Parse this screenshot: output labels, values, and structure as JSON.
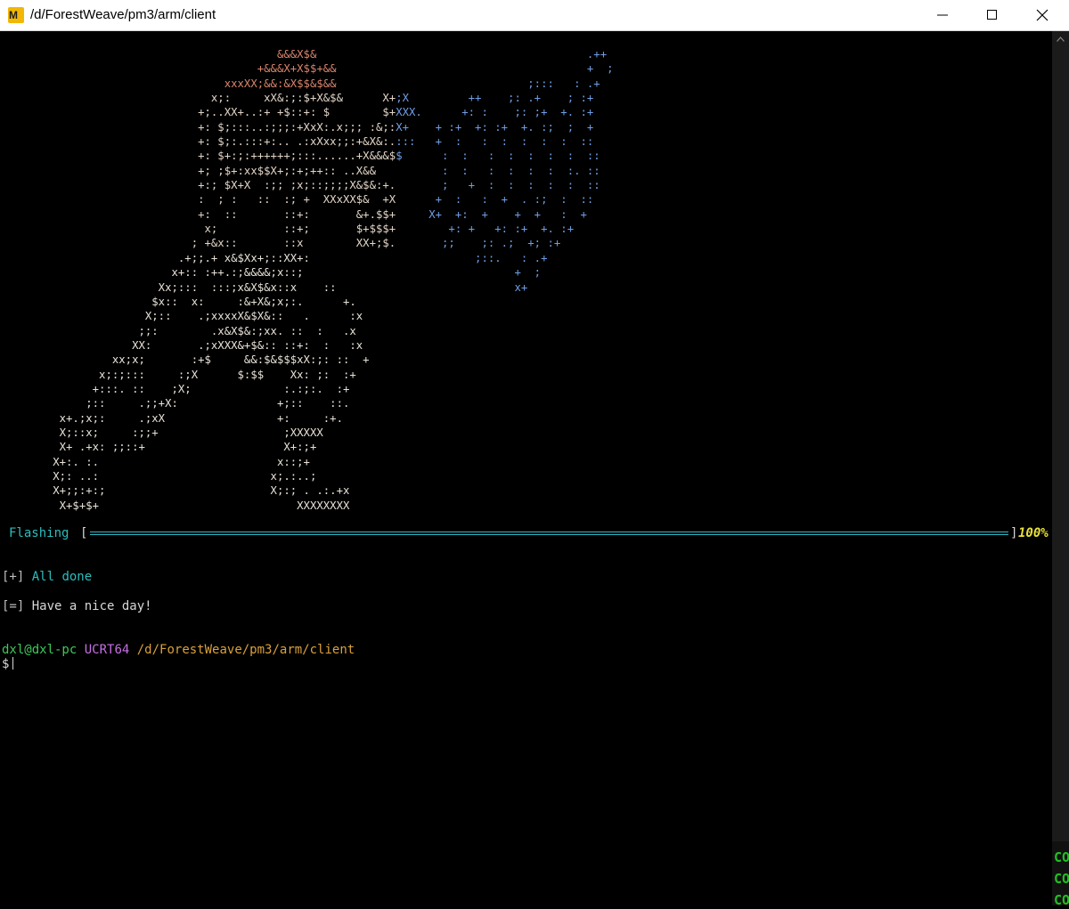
{
  "window": {
    "app_icon": "mintty-icon",
    "app_icon_text": "M",
    "title": "/d/ForestWeave/pm3/arm/client",
    "controls": [
      "minimize-icon",
      "maximize-icon",
      "close-icon"
    ]
  },
  "terminal": {
    "ascii_art_lines": [
      "                                          &&&X$&                                         .++",
      "                                       +&&&X+X$$+&&                                      +  ;",
      "                                  xxxXX;&&:&X$$&$&&                             ;:::   : .+",
      "                                x;:     xX&:;:$+X&$&      X+;X         ++    ;: .+    ; :+",
      "                              +;..XX+..:+ +$::+: $        $+XXX.      +: :    ;: ;+  +. :+",
      "                              +: $;:::..:;;;:+XxX:.x;;; :&;:X+    + :+  +: :+  +. :;  ;  +",
      "                              +: $;:.:::+:.. .:xXxx;;:+&X&:.:::   +  :   :  :  :  :  :  ::",
      "                              +: $+:;:++++++;:::......+X&&&$$      :  :   :  :  :  :  :  ::",
      "                              +; ;$+:xx$$X+;:+;++:: ..X&&          :  :   :  :  :  :  :. ::",
      "                              +:; $X+X  :;; ;x;::;;;;X&$&:+.       ;   +  :  :  :  :  :  ::",
      "                              :  ; :   ::  :; +  XXxXX$&  +X      +  :   :  +  . :;  :  ::",
      "                              +:  ::       ::+:       &+.$$+     X+  +:  +    +  +   :  +",
      "                               x;          ::+;       $+$$$+        +: +   +: :+  +. :+",
      "                             ; +&x::       ::x        XX+;$.       ;;    ;: .;  +; :+",
      "                           .+;;.+ x&$Xx+;::XX+:                         ;::.   : .+",
      "                          x+:: :++.:;&&&&;x::;                                +  ;",
      "                        Xx;:::  :::;x&X$&x::x    ::                           x+",
      "                       $x::  x:     :&+X&;x;:.      +.",
      "                      X;::    .;xxxxX&$X&::   .      :x",
      "                     ;;:        .x&X$&:;xx. ::  :   .x",
      "                    XX:       .;xXXX&+$&:: ::+:  :   :x",
      "                 xx;x;       :+$     &&:$&$$$xX:;: ::  +",
      "               x;:;:::     :;X      $:$$    Xx: ;:  :+",
      "              +:::. ::    ;X;              :.:;:.  :+",
      "             ;::     .;;+X:               +;::    ::.",
      "         x+.;x;:     .;xX                 +:     :+.",
      "         X;::x;     :;;+                   ;XXXXX",
      "         X+ .+x: ;;::+                     X+:;+",
      "        X+:. :.                           x::;+",
      "        X;: ..:                          x;.:..;",
      "        X+;;:+:;                         X;:; . .:.+x",
      "         X+$+$+                              XXXXXXXX"
    ],
    "progress": {
      "label": "Flashing",
      "bracket_open": "[",
      "bracket_close": "]",
      "fraction": 1.0,
      "percent_text": "100%"
    },
    "lines": {
      "done_tag": "[+]",
      "done_text": "All done",
      "bye_tag": "[=]",
      "bye_text": "Have a nice day!",
      "prompt_user": "dxl@dxl-pc",
      "prompt_env": "UCRT64",
      "prompt_path": "/d/ForestWeave/pm3/arm/client",
      "prompt_symbol": "$"
    }
  },
  "scrollbar": {
    "up_icon": "chevron-up-icon",
    "edge_text": [
      "CO",
      "CO",
      "CO"
    ]
  },
  "colors": {
    "background": "#000000",
    "cyan": "#2bbdbd",
    "yellow": "#e8e037",
    "green": "#3fc75b",
    "magenta": "#c66fe3",
    "orange": "#d9a13a"
  }
}
